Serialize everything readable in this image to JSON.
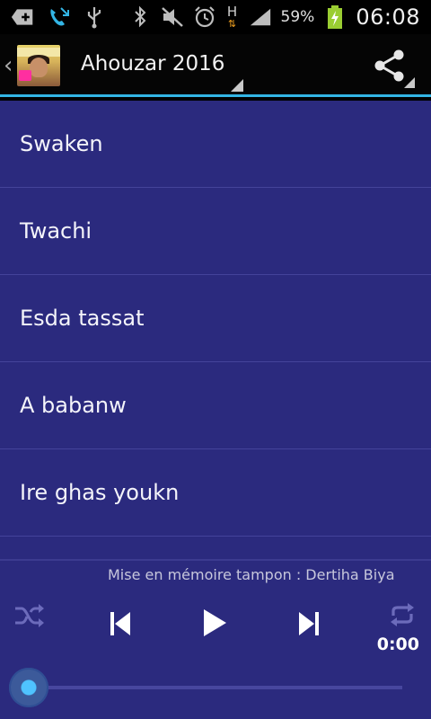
{
  "status_bar": {
    "battery_percent": "59%",
    "time": "06:08",
    "network_type": "H",
    "icons": [
      "add-icon",
      "missed-call-icon",
      "usb-icon",
      "bluetooth-icon",
      "silent-icon",
      "alarm-icon",
      "signal-icon",
      "battery-charging-icon"
    ]
  },
  "action_bar": {
    "title": "Ahouzar 2016",
    "accent_color": "#33b5e5"
  },
  "songs": [
    {
      "title": "Swaken"
    },
    {
      "title": "Twachi"
    },
    {
      "title": "Esda tassat"
    },
    {
      "title": "A babanw"
    },
    {
      "title": "Ire ghas youkn"
    }
  ],
  "player": {
    "buffering_text": "Mise en mémoire tampon : Dertiha Biya",
    "elapsed": "0:00",
    "progress": 0
  },
  "colors": {
    "background": "#2b2a7e",
    "text": "#f4f4fa",
    "accent": "#33b5e5"
  }
}
